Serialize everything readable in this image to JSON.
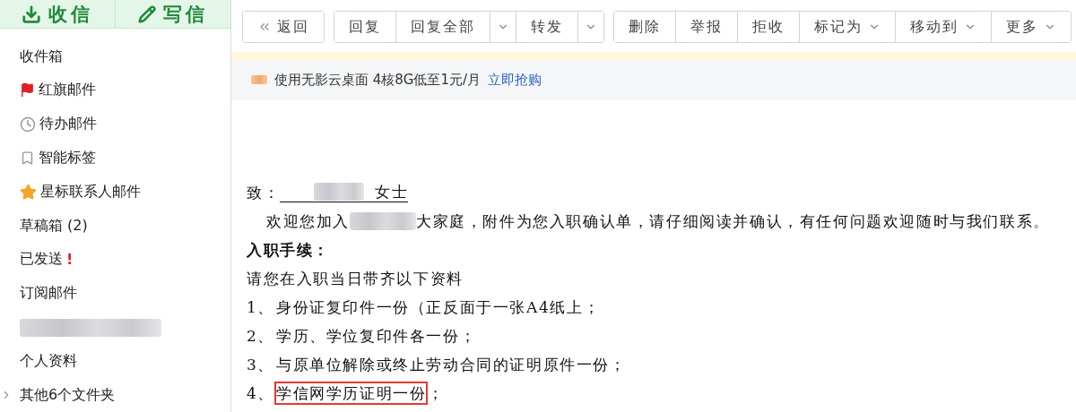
{
  "sidebar": {
    "actions": [
      {
        "kind": "receive",
        "label": "收信"
      },
      {
        "kind": "compose",
        "label": "写信"
      }
    ],
    "items": [
      {
        "kind": "plain",
        "label": "收件箱"
      },
      {
        "kind": "flag",
        "label": "红旗邮件"
      },
      {
        "kind": "clock",
        "label": "待办邮件"
      },
      {
        "kind": "bookmark",
        "label": "智能标签"
      },
      {
        "kind": "star",
        "label": "星标联系人邮件"
      },
      {
        "kind": "plain",
        "label": "草稿箱 (2)"
      },
      {
        "kind": "plain",
        "label": "已发送",
        "alert": "!"
      },
      {
        "kind": "plain",
        "label": "订阅邮件"
      },
      {
        "kind": "redacted"
      },
      {
        "kind": "plain",
        "label": "个人资料"
      },
      {
        "kind": "folder-group",
        "label": "其他6个文件夹"
      }
    ]
  },
  "toolbar": {
    "groups": [
      [
        {
          "kind": "back",
          "label": "返回"
        }
      ],
      [
        {
          "kind": "plain",
          "label": "回复"
        },
        {
          "kind": "split-dropdown",
          "label": "回复全部"
        },
        {
          "kind": "split-dropdown",
          "label": "转发"
        }
      ],
      [
        {
          "kind": "plain",
          "label": "删除"
        },
        {
          "kind": "plain",
          "label": "举报"
        },
        {
          "kind": "plain",
          "label": "拒收"
        },
        {
          "kind": "dropdown",
          "label": "标记为"
        },
        {
          "kind": "dropdown",
          "label": "移动到"
        },
        {
          "kind": "dropdown",
          "label": "更多"
        }
      ]
    ]
  },
  "ad": {
    "text": "使用无影云桌面 4核8G低至1元/月",
    "link": "立即抢购"
  },
  "letter": {
    "greeting": {
      "prefix": "致：",
      "suffix": "女士"
    },
    "welcome": {
      "before": "欢迎您加入",
      "after": "大家庭，附件为您入职确认单，请仔细阅读并确认，有任何问题欢迎随时与我们联系。"
    },
    "heading": "入职手续：",
    "intro": "请您在入职当日带齐以下资料",
    "items": [
      {
        "number": "1、",
        "text": "身份证复印件一份（正反面于一张A4纸上；",
        "highlighted": false
      },
      {
        "number": "2、",
        "text": "学历、学位复印件各一份；",
        "highlighted": false
      },
      {
        "number": "3、",
        "text": "与原单位解除或终止劳动合同的证明原件一份；",
        "highlighted": false
      },
      {
        "number": "4、",
        "text": "学信网学历证明一份",
        "suffix": "；",
        "highlighted": true
      }
    ]
  }
}
